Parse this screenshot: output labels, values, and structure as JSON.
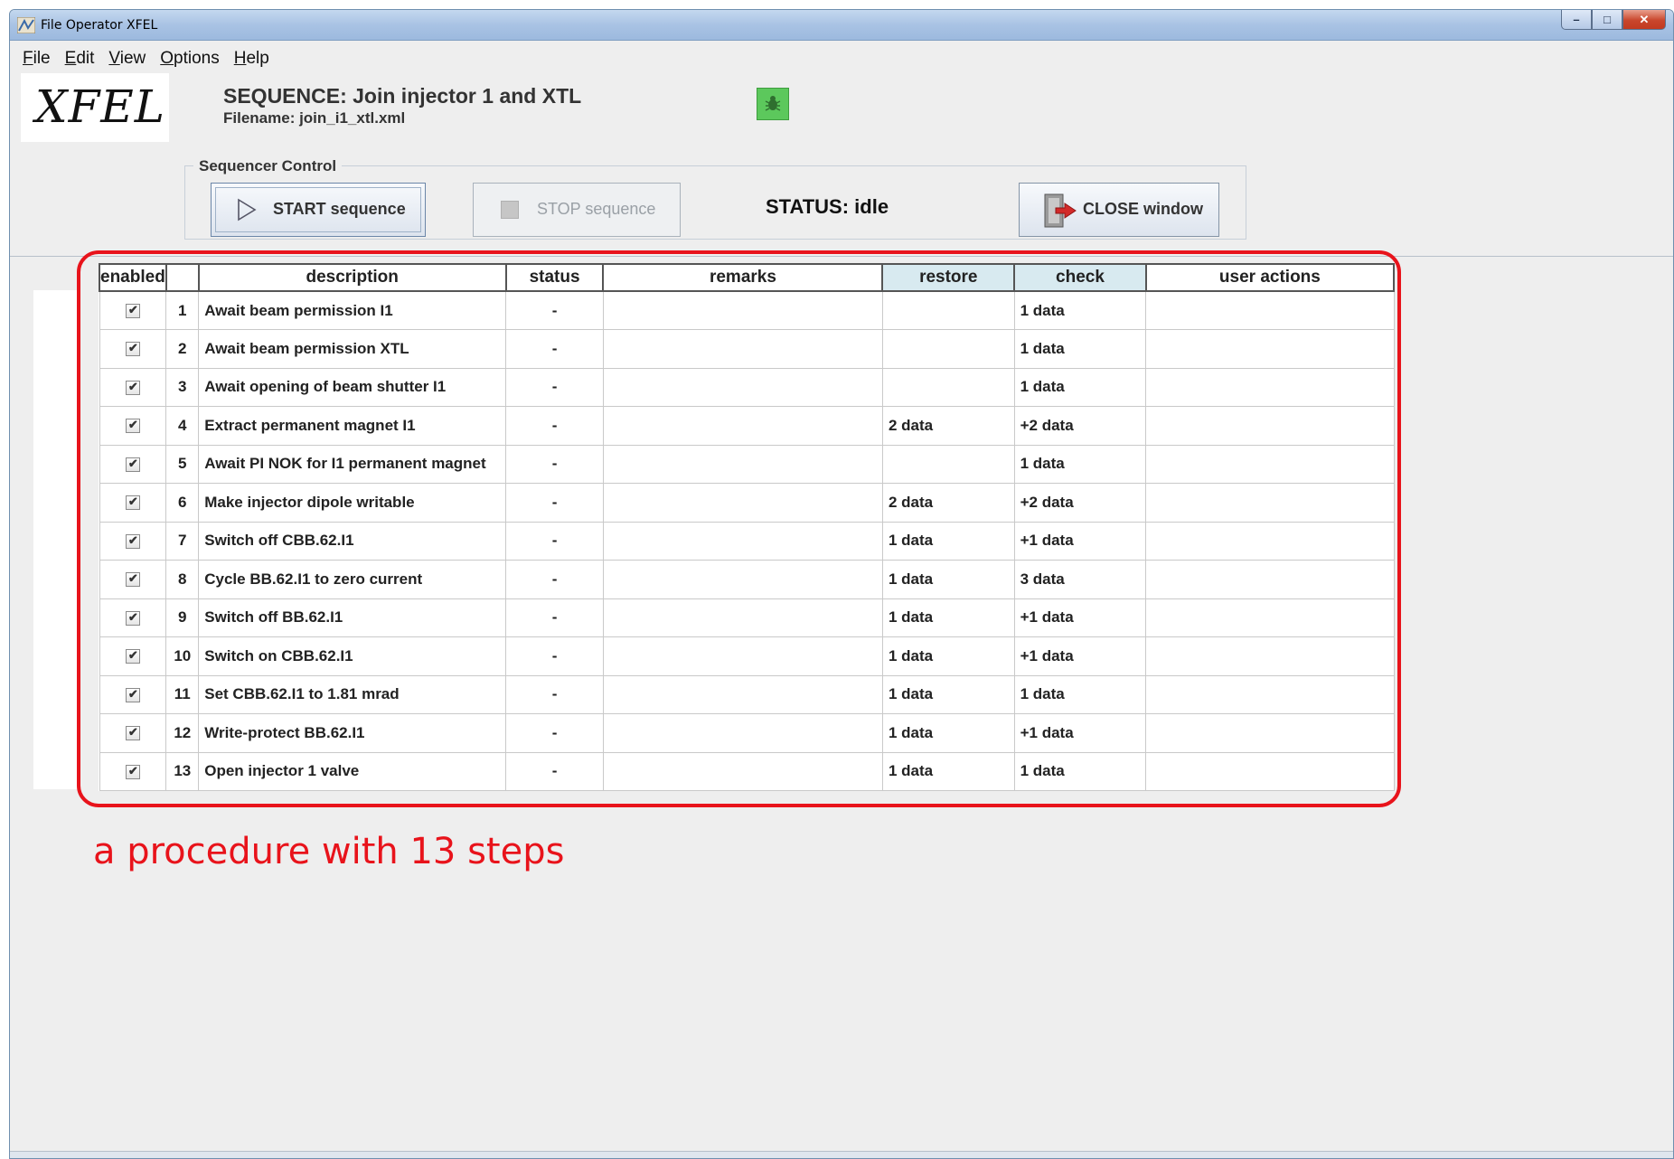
{
  "window": {
    "title": "File Operator XFEL"
  },
  "menu": [
    "File",
    "Edit",
    "View",
    "Options",
    "Help"
  ],
  "header": {
    "logo_text": "XFEL",
    "sequence_title": "SEQUENCE: Join injector 1 and XTL",
    "filename": "Filename: join_i1_xtl.xml"
  },
  "control": {
    "group_label": "Sequencer Control",
    "start_label": "START sequence",
    "stop_label": "STOP sequence",
    "status_text": "STATUS:  idle",
    "close_label": "CLOSE window"
  },
  "table": {
    "columns": [
      "enabled",
      "",
      "description",
      "status",
      "remarks",
      "restore",
      "check",
      "user actions"
    ],
    "rows": [
      {
        "enabled": true,
        "num": "1",
        "description": "Await beam permission I1",
        "status": "-",
        "remarks": "",
        "restore": "",
        "check": "1 data",
        "user_actions": ""
      },
      {
        "enabled": true,
        "num": "2",
        "description": "Await beam permission XTL",
        "status": "-",
        "remarks": "",
        "restore": "",
        "check": "1 data",
        "user_actions": ""
      },
      {
        "enabled": true,
        "num": "3",
        "description": "Await opening of beam shutter I1",
        "status": "-",
        "remarks": "",
        "restore": "",
        "check": "1 data",
        "user_actions": ""
      },
      {
        "enabled": true,
        "num": "4",
        "description": "Extract permanent magnet I1",
        "status": "-",
        "remarks": "",
        "restore": "2 data",
        "check": "+2 data",
        "user_actions": ""
      },
      {
        "enabled": true,
        "num": "5",
        "description": "Await PI NOK for I1 permanent magnet",
        "status": "-",
        "remarks": "",
        "restore": "",
        "check": "1 data",
        "user_actions": ""
      },
      {
        "enabled": true,
        "num": "6",
        "description": "Make injector dipole writable",
        "status": "-",
        "remarks": "",
        "restore": "2 data",
        "check": "+2 data",
        "user_actions": ""
      },
      {
        "enabled": true,
        "num": "7",
        "description": "Switch off CBB.62.I1",
        "status": "-",
        "remarks": "",
        "restore": "1 data",
        "check": "+1 data",
        "user_actions": ""
      },
      {
        "enabled": true,
        "num": "8",
        "description": "Cycle BB.62.I1 to zero current",
        "status": "-",
        "remarks": "",
        "restore": "1 data",
        "check": "3 data",
        "user_actions": ""
      },
      {
        "enabled": true,
        "num": "9",
        "description": "Switch off BB.62.I1",
        "status": "-",
        "remarks": "",
        "restore": "1 data",
        "check": "+1 data",
        "user_actions": ""
      },
      {
        "enabled": true,
        "num": "10",
        "description": "Switch on CBB.62.I1",
        "status": "-",
        "remarks": "",
        "restore": "1 data",
        "check": "+1 data",
        "user_actions": ""
      },
      {
        "enabled": true,
        "num": "11",
        "description": "Set CBB.62.I1 to 1.81 mrad",
        "status": "-",
        "remarks": "",
        "restore": "1 data",
        "check": "1 data",
        "user_actions": ""
      },
      {
        "enabled": true,
        "num": "12",
        "description": "Write-protect BB.62.I1",
        "status": "-",
        "remarks": "",
        "restore": "1 data",
        "check": "+1 data",
        "user_actions": ""
      },
      {
        "enabled": true,
        "num": "13",
        "description": "Open injector 1 valve",
        "status": "-",
        "remarks": "",
        "restore": "1 data",
        "check": "1 data",
        "user_actions": ""
      }
    ]
  },
  "annotation": {
    "text": "a procedure with 13 steps",
    "color": "#e8131b"
  },
  "colors": {
    "highlight_header": "#d8eaf0",
    "debug_icon": "#5cc85c"
  },
  "icons": [
    "app-icon",
    "minimize-icon",
    "maximize-icon",
    "close-icon",
    "bug-icon",
    "play-icon",
    "stop-icon",
    "exit-door-icon"
  ]
}
